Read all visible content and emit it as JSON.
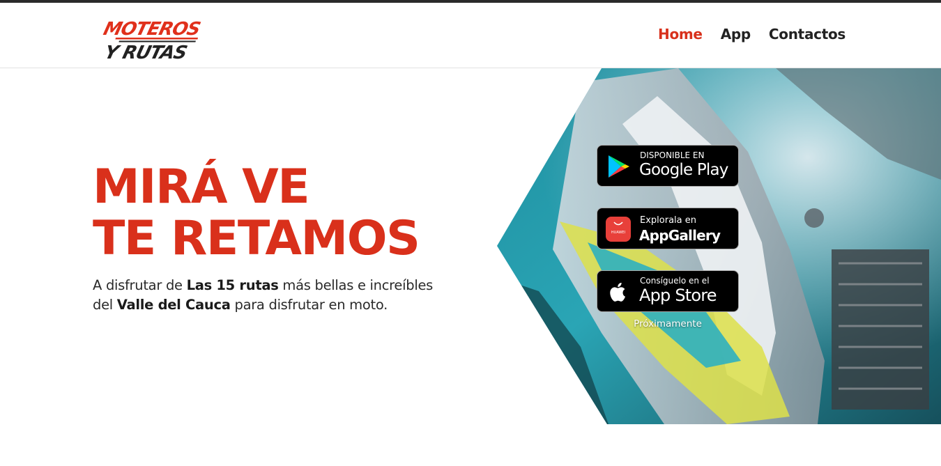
{
  "brand": {
    "logo_line1": "MOTEROS",
    "logo_line2": "Y RUTAS",
    "accent": "#d9301b"
  },
  "nav": {
    "items": [
      {
        "label": "Home",
        "active": true
      },
      {
        "label": "App",
        "active": false
      },
      {
        "label": "Contactos",
        "active": false
      }
    ]
  },
  "hero": {
    "title_line1": "MIRÁ VE",
    "title_line2": "TE RETAMOS",
    "desc_part1": "A disfrutar de ",
    "desc_bold1": "Las 15 rutas",
    "desc_part2": " más bellas e increíbles del ",
    "desc_bold2": "Valle del Cauca",
    "desc_part3": " para disfrutar en moto."
  },
  "badges": {
    "google": {
      "small": "DISPONIBLE EN",
      "big": "Google Play",
      "icon": "google-play-icon"
    },
    "huawei": {
      "small": "Explorala en",
      "big": "AppGallery",
      "icon": "huawei-appgallery-icon",
      "icon_label": "HUAWEI"
    },
    "apple": {
      "small": "Consíguelo en el",
      "big": "App Store",
      "icon": "apple-icon"
    }
  },
  "coming_soon": "Próximamente"
}
